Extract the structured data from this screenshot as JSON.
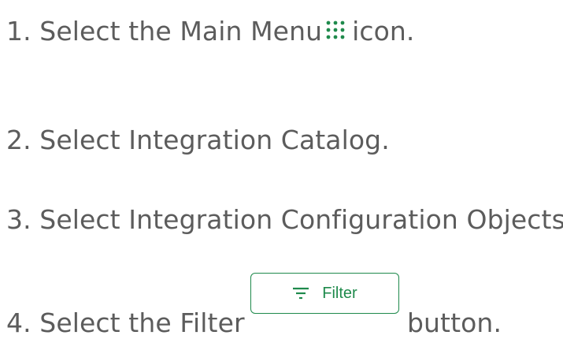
{
  "colors": {
    "text": "#5c5c5c",
    "accent": "#1f8a4c"
  },
  "steps": [
    {
      "number": "1.",
      "before": "Select the Main Menu",
      "icon": "main-menu-grid-icon",
      "after": "icon."
    },
    {
      "number": "2.",
      "text": "Select Integration Catalog."
    },
    {
      "number": "3.",
      "text": "Select Integration Configuration Objects."
    },
    {
      "number": "4.",
      "before": "Select the Filter",
      "after": "button."
    }
  ],
  "filter_button": {
    "label": "Filter",
    "icon": "filter-lines-icon"
  }
}
